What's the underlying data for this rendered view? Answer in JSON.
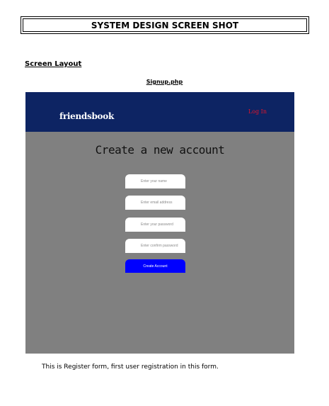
{
  "document": {
    "title": "SYSTEM DESIGN SCREEN SHOT",
    "section_heading": "Screen Layout",
    "file_label": "Signup.php",
    "caption": "This is Register form, first user registration in this form."
  },
  "app": {
    "brand": "friendsbook",
    "login_link": "Log In",
    "form_heading": "Create a new account",
    "fields": {
      "name_placeholder": "Enter your name",
      "email_placeholder": "Enter email address",
      "password_placeholder": "Enter your password",
      "confirm_placeholder": "Enter confirm password"
    },
    "submit_label": "Create Account"
  },
  "colors": {
    "navbar": "#0d2463",
    "page_background": "#808080",
    "login_link": "#e0142a",
    "button": "#0000ff"
  }
}
